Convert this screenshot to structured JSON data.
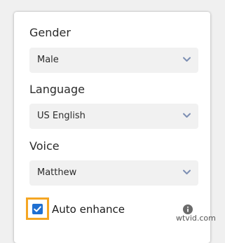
{
  "form": {
    "gender": {
      "label": "Gender",
      "value": "Male"
    },
    "language": {
      "label": "Language",
      "value": "US English"
    },
    "voice": {
      "label": "Voice",
      "value": "Matthew"
    },
    "auto_enhance": {
      "label": "Auto enhance",
      "checked": true
    }
  },
  "icons": {
    "dropdown": "chevron-down-icon",
    "info": "info-icon",
    "check": "checkmark-icon"
  },
  "colors": {
    "checkbox_fill": "#1f6fd1",
    "focus_ring": "#f5a623",
    "chevron": "#7d8fb3"
  },
  "watermark": {
    "text": "wtvid.com"
  }
}
